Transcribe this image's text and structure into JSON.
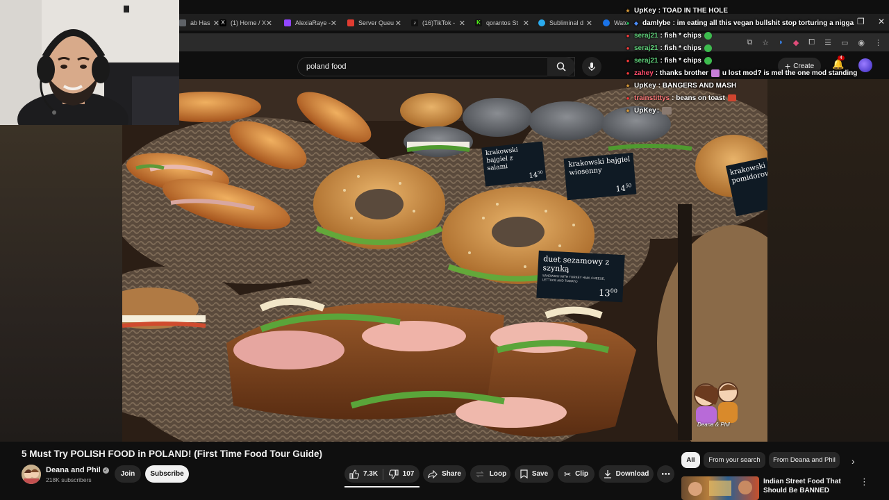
{
  "browser": {
    "tabs": [
      {
        "label": "ab Has",
        "color": "#5f6368",
        "glyph": ""
      },
      {
        "label": "(1) Home / X",
        "color": "#000000",
        "glyph": "X"
      },
      {
        "label": "AlexiaRaye -",
        "color": "#9146ff",
        "glyph": ""
      },
      {
        "label": "Server Queu",
        "color": "#e03c31",
        "glyph": ""
      },
      {
        "label": "(16)TikTok -",
        "color": "#111111",
        "glyph": "♪"
      },
      {
        "label": "qorantos St",
        "color": "#53fc18",
        "glyph": "K"
      },
      {
        "label": "Subliminal d",
        "color": "#2aabee",
        "glyph": ""
      },
      {
        "label": "Watc",
        "color": "#1a73e8",
        "glyph": ""
      }
    ]
  },
  "youtube": {
    "search_query": "poland food",
    "create_label": "Create",
    "notification_count": "4"
  },
  "chat": {
    "messages": [
      {
        "user": "UpKey",
        "user_color": "#ffffff",
        "text": ": TOAD IN THE HOLE",
        "badge": "★",
        "badge_color": "#e3a13b"
      },
      {
        "user": "damlybe",
        "user_color": "#ffffff",
        "text": ": im eating all this vegan bullshit stop torturing a nigga",
        "badge": "●",
        "badge_color": "#1db954"
      },
      {
        "user": "seraj21",
        "user_color": "#5fd07a",
        "text": ": fish * chips",
        "badge": "●",
        "badge_color": "#ff3b3b",
        "emote": true
      },
      {
        "user": "seraj21",
        "user_color": "#5fd07a",
        "text": ": fish * chips",
        "badge": "●",
        "badge_color": "#ff3b3b",
        "emote": true
      },
      {
        "user": "seraj21",
        "user_color": "#5fd07a",
        "text": ": fish * chips",
        "badge": "●",
        "badge_color": "#ff3b3b",
        "emote": true
      },
      {
        "user": "zahey",
        "user_color": "#ff4d6d",
        "text": ": thanks brother",
        "text2": "u lost mod? is mel the one mod standing",
        "badge": "●",
        "badge_color": "#ff3b3b"
      },
      {
        "user": "UpKey",
        "user_color": "#ffffff",
        "text": ": BANGERS AND MASH",
        "badge": "★",
        "badge_color": "#e3a13b"
      },
      {
        "user": "trainstittys",
        "user_color": "#ff7b7b",
        "text": ": beans on toast",
        "badge": "●",
        "badge_color": "#ff3b3b"
      },
      {
        "user": "UpKey",
        "user_color": "#ffffff",
        "text": ":",
        "badge": "★",
        "badge_color": "#e3a13b"
      }
    ]
  },
  "video": {
    "signs": {
      "sign1_title": "krakowski bajgiel z salami",
      "sign1_price": "14",
      "sign1_cents": "50",
      "sign2_title": "krakowski bajgiel wiosenny",
      "sign2_price": "14",
      "sign2_cents": "50",
      "sign3_title": "duet sezamowy z szynką",
      "sign3_desc": "SANDWICH WITH TURKEY HAM, CHEESE, LETTUCE AND TOMATO",
      "sign3_price": "13",
      "sign3_cents": "00",
      "sign4_title": "krakowski pomidorowy",
      "watermark": "Deana & Phil"
    },
    "title": "5 Must Try POLISH FOOD in POLAND! (First Time Food Tour Guide)",
    "channel": "Deana and Phil",
    "subscribers": "218K subscribers",
    "join_label": "Join",
    "subscribe_label": "Subscribe",
    "likes": "7.3K",
    "dislikes": "107",
    "share_label": "Share",
    "loop_label": "Loop",
    "save_label": "Save",
    "clip_label": "Clip",
    "download_label": "Download"
  },
  "chips": [
    "All",
    "From your search",
    "From Deana and Phil"
  ],
  "recommended": {
    "title": "Indian Street Food That Should Be BANNED"
  },
  "colors": {
    "background": "#0f0f0f",
    "pill": "#272727",
    "sign": "#101820",
    "accent_red": "#cc0000"
  }
}
